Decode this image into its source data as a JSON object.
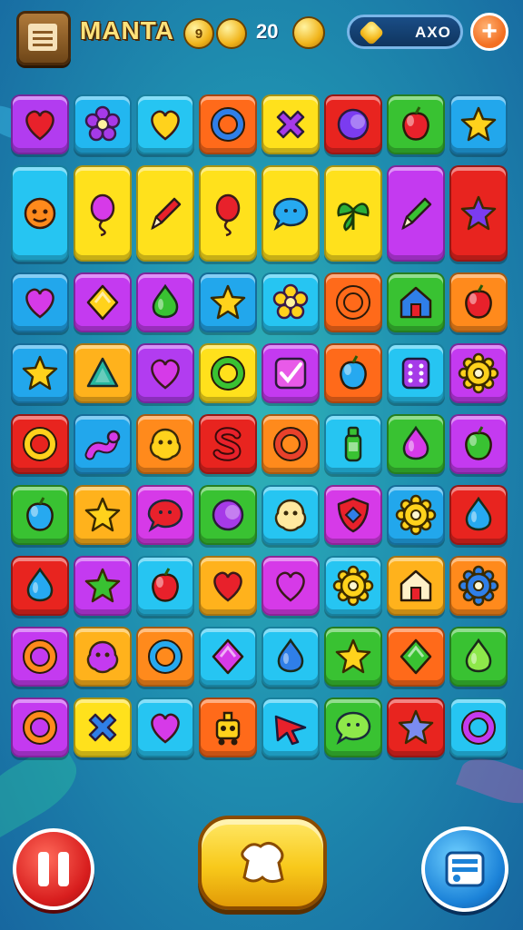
{
  "hud": {
    "player_name": "MANTA",
    "coin_glyph": "9",
    "coin_count": "20",
    "gem_label": "AXO",
    "add_symbol": "+"
  },
  "board": {
    "rows": [
      {
        "tall": false,
        "tiles": [
          {
            "color": "#b23cf0",
            "icon": "heart",
            "fill": "#e8212b"
          },
          {
            "color": "#22b7f0",
            "icon": "flower",
            "fill": "#a63ae8"
          },
          {
            "color": "#26c5f2",
            "icon": "heart",
            "fill": "#ffd21c"
          },
          {
            "color": "#ff6a1a",
            "icon": "ring",
            "fill": "#2f7fe8"
          },
          {
            "color": "#ffe11c",
            "icon": "cross",
            "fill": "#a63ae8"
          },
          {
            "color": "#e8241f",
            "icon": "moon",
            "fill": "#7b3cf0"
          },
          {
            "color": "#39c232",
            "icon": "fruit",
            "fill": "#e8212b"
          },
          {
            "color": "#22a7ec",
            "icon": "star",
            "fill": "#ffd21c"
          }
        ]
      },
      {
        "tall": true,
        "tiles": [
          {
            "color": "#26c5f2",
            "icon": "face",
            "fill": "#ff8a1c"
          },
          {
            "color": "#ffe11c",
            "icon": "balloon",
            "fill": "#d63ae8"
          },
          {
            "color": "#ffe11c",
            "icon": "pen",
            "fill": "#e8212b"
          },
          {
            "color": "#ffe11c",
            "icon": "balloon",
            "fill": "#e8212b"
          },
          {
            "color": "#ffe11c",
            "icon": "chat",
            "fill": "#26a9f0"
          },
          {
            "color": "#ffe11c",
            "icon": "leaf",
            "fill": "#2bb03a"
          },
          {
            "color": "#c43af0",
            "icon": "pen",
            "fill": "#39c232"
          },
          {
            "color": "#e8241f",
            "icon": "star",
            "fill": "#7b3cf0"
          }
        ]
      },
      {
        "tall": false,
        "tiles": [
          {
            "color": "#22a7ec",
            "icon": "heart",
            "fill": "#d63ae8"
          },
          {
            "color": "#c43af0",
            "icon": "diamond",
            "fill": "#ffd21c"
          },
          {
            "color": "#c43af0",
            "icon": "drop",
            "fill": "#39c232"
          },
          {
            "color": "#22a7ec",
            "icon": "star",
            "fill": "#ffd21c"
          },
          {
            "color": "#26c5f2",
            "icon": "flower",
            "fill": "#ffd21c"
          },
          {
            "color": "#ff6a1a",
            "icon": "ring",
            "fill": "#ff6a1a"
          },
          {
            "color": "#39c232",
            "icon": "house",
            "fill": "#2f7fe8"
          },
          {
            "color": "#ff8a1c",
            "icon": "fruit",
            "fill": "#e8212b"
          }
        ]
      },
      {
        "tall": false,
        "tiles": [
          {
            "color": "#22a7ec",
            "icon": "star",
            "fill": "#ffd21c"
          },
          {
            "color": "#ffb21c",
            "icon": "triangle",
            "fill": "#26b7a0"
          },
          {
            "color": "#b23cf0",
            "icon": "heart",
            "fill": "#d63ae8"
          },
          {
            "color": "#ffe11c",
            "icon": "ring",
            "fill": "#39c232"
          },
          {
            "color": "#c43af0",
            "icon": "check",
            "fill": "#e85ae8"
          },
          {
            "color": "#ff6a1a",
            "icon": "fruit",
            "fill": "#26a9f0"
          },
          {
            "color": "#26c5f2",
            "icon": "dice",
            "fill": "#a63ae8"
          },
          {
            "color": "#c43af0",
            "icon": "gear",
            "fill": "#ffd21c"
          }
        ]
      },
      {
        "tall": false,
        "tiles": [
          {
            "color": "#e8241f",
            "icon": "ring",
            "fill": "#ffd21c"
          },
          {
            "color": "#22a7ec",
            "icon": "worm",
            "fill": "#d63ae8"
          },
          {
            "color": "#ff8a1c",
            "icon": "blob",
            "fill": "#ffd21c"
          },
          {
            "color": "#e8241f",
            "icon": "dollar",
            "fill": "#e8212b"
          },
          {
            "color": "#ff8a1c",
            "icon": "ring",
            "fill": "#e8412b"
          },
          {
            "color": "#26c5f2",
            "icon": "bottle",
            "fill": "#39c232"
          },
          {
            "color": "#39c232",
            "icon": "drop",
            "fill": "#d63ae8"
          },
          {
            "color": "#c43af0",
            "icon": "fruit",
            "fill": "#39c232"
          }
        ]
      },
      {
        "tall": false,
        "tiles": [
          {
            "color": "#39c232",
            "icon": "fruit",
            "fill": "#26a9f0"
          },
          {
            "color": "#ffb21c",
            "icon": "star",
            "fill": "#ffd21c"
          },
          {
            "color": "#d63ae8",
            "icon": "chat",
            "fill": "#e8212b"
          },
          {
            "color": "#39c232",
            "icon": "moon",
            "fill": "#a63ae8"
          },
          {
            "color": "#26c5f2",
            "icon": "blob",
            "fill": "#ffe9a0"
          },
          {
            "color": "#d63ae8",
            "icon": "shield",
            "fill": "#e8212b"
          },
          {
            "color": "#22a7ec",
            "icon": "gear",
            "fill": "#ffd21c"
          },
          {
            "color": "#e8241f",
            "icon": "drop",
            "fill": "#26a9f0"
          }
        ]
      },
      {
        "tall": false,
        "tiles": [
          {
            "color": "#e8241f",
            "icon": "drop",
            "fill": "#26a9f0"
          },
          {
            "color": "#c43af0",
            "icon": "star",
            "fill": "#39c232"
          },
          {
            "color": "#26c5f2",
            "icon": "fruit",
            "fill": "#e8212b"
          },
          {
            "color": "#ffb21c",
            "icon": "heart",
            "fill": "#e8212b"
          },
          {
            "color": "#d63ae8",
            "icon": "heart",
            "fill": "#d63ae8"
          },
          {
            "color": "#26c5f2",
            "icon": "gear",
            "fill": "#ffd21c"
          },
          {
            "color": "#ffb21c",
            "icon": "house",
            "fill": "#fff1c8"
          },
          {
            "color": "#ff8a1c",
            "icon": "gear",
            "fill": "#2f7fe8"
          }
        ]
      },
      {
        "tall": false,
        "tiles": [
          {
            "color": "#c43af0",
            "icon": "ring",
            "fill": "#ff8a1c"
          },
          {
            "color": "#ffb21c",
            "icon": "blob",
            "fill": "#c43af0"
          },
          {
            "color": "#ff8a1c",
            "icon": "ring",
            "fill": "#26a9f0"
          },
          {
            "color": "#26c5f2",
            "icon": "diamond",
            "fill": "#d63ae8"
          },
          {
            "color": "#26c5f2",
            "icon": "drop",
            "fill": "#2f7fe8"
          },
          {
            "color": "#39c232",
            "icon": "star",
            "fill": "#ffd21c"
          },
          {
            "color": "#ff6a1a",
            "icon": "diamond",
            "fill": "#39c232"
          },
          {
            "color": "#39c232",
            "icon": "drop",
            "fill": "#8ee84a"
          }
        ]
      },
      {
        "tall": false,
        "tiles": [
          {
            "color": "#c43af0",
            "icon": "ring",
            "fill": "#ff8a1c"
          },
          {
            "color": "#ffe11c",
            "icon": "cross",
            "fill": "#2f7fe8"
          },
          {
            "color": "#26c5f2",
            "icon": "heart",
            "fill": "#d63ae8"
          },
          {
            "color": "#ff6a1a",
            "icon": "robot",
            "fill": "#ffd21c"
          },
          {
            "color": "#26c5f2",
            "icon": "arrow",
            "fill": "#e8212b"
          },
          {
            "color": "#39c232",
            "icon": "chat",
            "fill": "#8ee84a"
          },
          {
            "color": "#e8241f",
            "icon": "star",
            "fill": "#7b8cf0"
          },
          {
            "color": "#26c5f2",
            "icon": "ring",
            "fill": "#c43af0"
          }
        ]
      }
    ]
  },
  "controls": {
    "pause_icon": "pause-icon",
    "center_icon": "tile-shuffle-icon",
    "shop_icon": "ticket-icon"
  }
}
